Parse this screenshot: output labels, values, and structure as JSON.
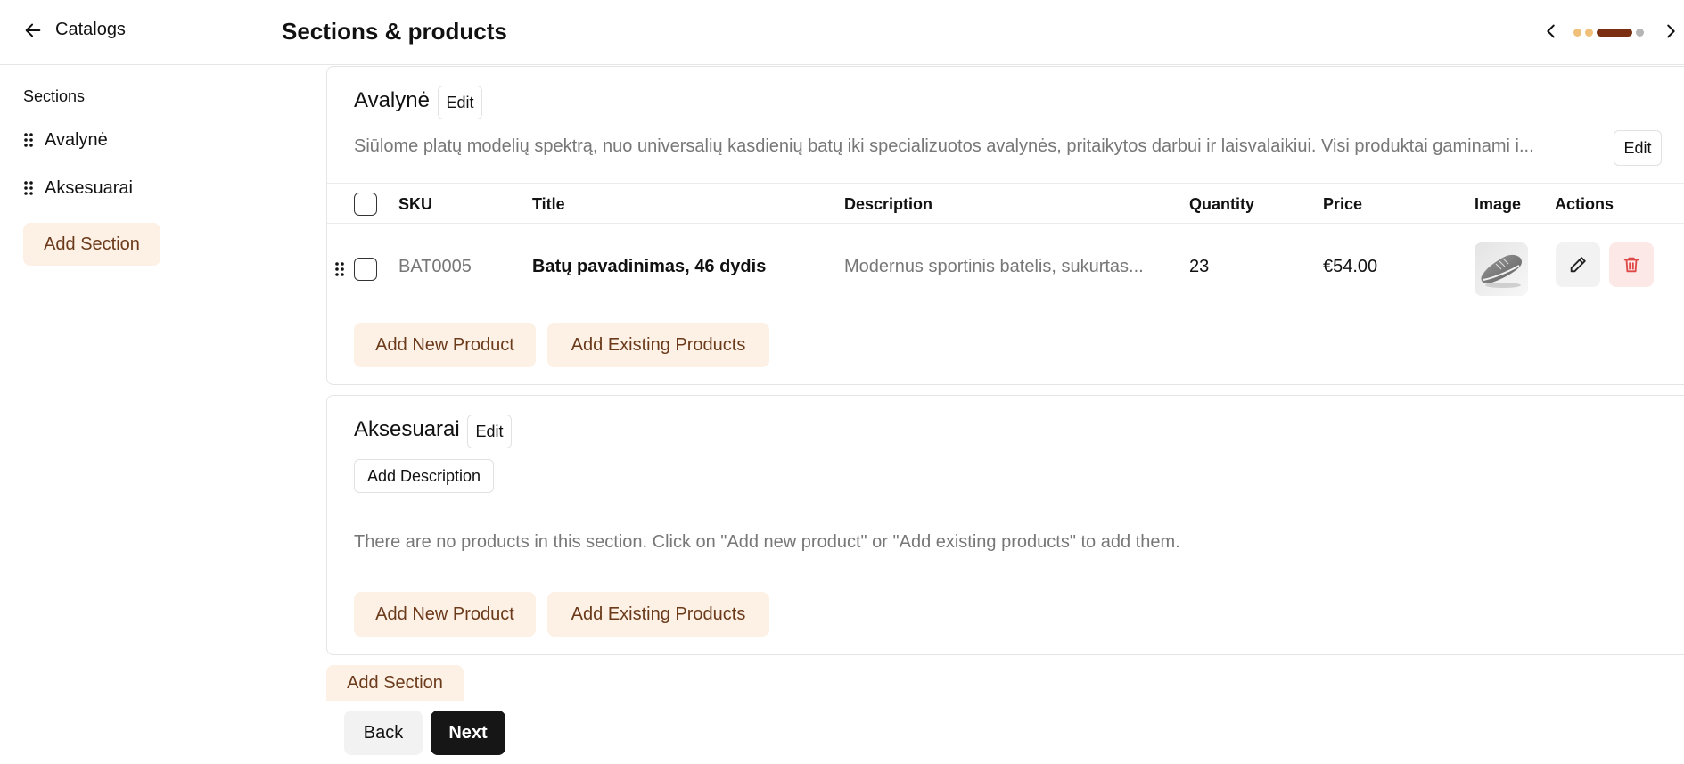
{
  "header": {
    "back_label": "Catalogs",
    "back_icon": "arrow-left-icon",
    "title": "Sections & products",
    "stepper": {
      "prev_icon": "chevron-left-icon",
      "next_icon": "chevron-right-icon",
      "dot_colors": [
        "#f0c07a",
        "#f0c07a",
        "#7a2e12",
        "#b5b5b5"
      ],
      "active_index": 2
    }
  },
  "sidebar": {
    "heading": "Sections",
    "items": [
      {
        "label": "Avalynė",
        "icon": "drag-handle-icon"
      },
      {
        "label": "Aksesuarai",
        "icon": "drag-handle-icon"
      }
    ],
    "add_section_label": "Add Section"
  },
  "sections": [
    {
      "title": "Avalynė",
      "edit_title_label": "Edit",
      "description": "Siūlome platų modelių spektrą, nuo universalių kasdienių batų iki specializuotos avalynės, pritaikytos darbui ir laisvalaikiui. Visi produktai gaminami i...",
      "edit_description_label": "Edit",
      "columns": [
        "SKU",
        "Title",
        "Description",
        "Quantity",
        "Price",
        "Image",
        "Actions"
      ],
      "products": [
        {
          "sku": "BAT0005",
          "title": "Batų pavadinimas, 46 dydis",
          "description": "Modernus sportinis batelis, sukurtas...",
          "quantity": "23",
          "price": "€54.00",
          "image_icon": "sneaker-image",
          "edit_icon": "pencil-icon",
          "delete_icon": "trash-icon"
        }
      ],
      "add_new_label": "Add New Product",
      "add_existing_label": "Add Existing Products"
    },
    {
      "title": "Aksesuarai",
      "edit_title_label": "Edit",
      "add_description_label": "Add Description",
      "empty_message": "There are no products in this section. Click on \"Add new product\" or \"Add existing products\" to add them.",
      "add_new_label": "Add New Product",
      "add_existing_label": "Add Existing Products"
    }
  ],
  "main": {
    "add_section_label": "Add Section"
  },
  "footer": {
    "back_label": "Back",
    "next_label": "Next"
  },
  "colors": {
    "accent_soft_bg": "#fdf1e6",
    "accent_text": "#6b3a1a",
    "primary_dark": "#161616",
    "danger": "#e04848",
    "danger_bg": "#fde8e8"
  }
}
